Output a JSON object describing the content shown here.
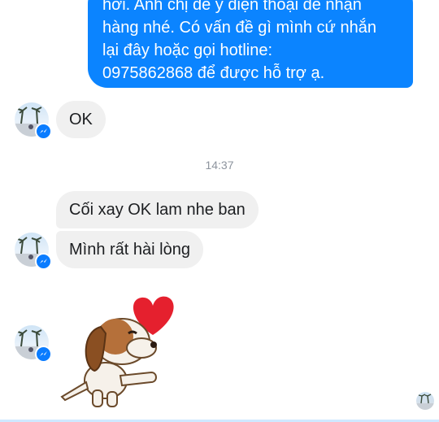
{
  "conversation": {
    "outgoing_message": "hơi. Anh chị để ý điện thoại để nhận\nhàng nhé. Có vấn đề gì mình cứ nhắn\nlại đây hoặc gọi hotline:\n0975862868 để được hỗ trợ ạ.",
    "incoming_ok": "OK",
    "timestamp": "14:37",
    "incoming_line1": "Cối xay OK lam nhe ban",
    "incoming_line2": "Mình rất hài lòng"
  },
  "colors": {
    "outgoing_bubble": "#0b84ff",
    "incoming_bubble": "#f0f0f0",
    "messenger_badge": "#0a7cff",
    "heart": "#e5202e"
  },
  "icons": {
    "badge": "messenger-icon",
    "sticker": "puppy-heart-sticker"
  }
}
